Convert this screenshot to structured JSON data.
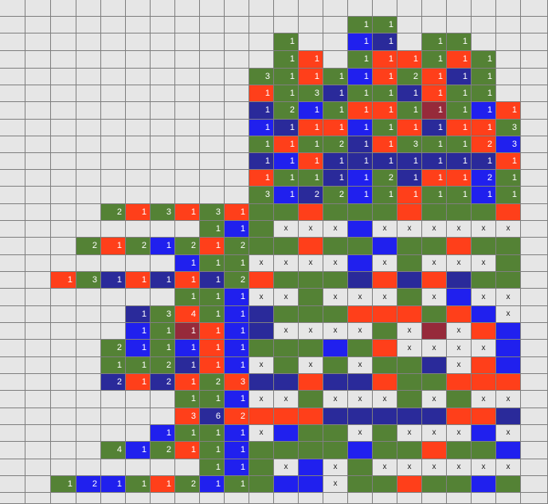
{
  "colors": {
    "e": "#e6e6e6",
    "g": "#548235",
    "r": "#ff3f1a",
    "b": "#2020ee",
    "n": "#2a2a9a",
    "m": "#962a3a",
    "gridline": "#7f7f7f"
  },
  "grid": {
    "columns": 22,
    "rows": 29,
    "cells": [
      [
        "e",
        "e",
        "e",
        "e",
        "e",
        "e",
        "e",
        "e",
        "e",
        "e",
        "e",
        "e",
        "e",
        "e",
        "e",
        "e",
        "e",
        "e",
        "e",
        "e",
        "e",
        "e"
      ],
      [
        "e",
        "e",
        "e",
        "e",
        "e",
        "e",
        "e",
        "e",
        "e",
        "e",
        "e",
        "e",
        "e",
        "e",
        "g:1",
        "g:1",
        "e",
        "e",
        "e",
        "e",
        "e",
        "e"
      ],
      [
        "e",
        "e",
        "e",
        "e",
        "e",
        "e",
        "e",
        "e",
        "e",
        "e",
        "e",
        "g:1",
        "e",
        "e",
        "b:1",
        "n:1",
        "e",
        "g:1",
        "g:1",
        "e",
        "e",
        "e"
      ],
      [
        "e",
        "e",
        "e",
        "e",
        "e",
        "e",
        "e",
        "e",
        "e",
        "e",
        "e",
        "g:1",
        "r:1",
        "e",
        "g:1",
        "r:1",
        "r:1",
        "g:1",
        "r:1",
        "g:1",
        "e",
        "e"
      ],
      [
        "e",
        "e",
        "e",
        "e",
        "e",
        "e",
        "e",
        "e",
        "e",
        "e",
        "g:3",
        "g:1",
        "r:1",
        "g:1",
        "b:1",
        "r:1",
        "g:2",
        "r:1",
        "n:1",
        "g:1",
        "e",
        "e"
      ],
      [
        "e",
        "e",
        "e",
        "e",
        "e",
        "e",
        "e",
        "e",
        "e",
        "e",
        "r:1",
        "g:1",
        "g:3",
        "n:1",
        "g:1",
        "g:1",
        "n:1",
        "r:1",
        "g:1",
        "g:1",
        "e",
        "e"
      ],
      [
        "e",
        "e",
        "e",
        "e",
        "e",
        "e",
        "e",
        "e",
        "e",
        "e",
        "n:1",
        "g:2",
        "b:1",
        "g:1",
        "r:1",
        "r:1",
        "g:1",
        "m:1",
        "g:1",
        "b:1",
        "r:1",
        "e"
      ],
      [
        "e",
        "e",
        "e",
        "e",
        "e",
        "e",
        "e",
        "e",
        "e",
        "e",
        "b:1",
        "n:1",
        "r:1",
        "r:1",
        "b:1",
        "g:1",
        "r:1",
        "n:1",
        "r:1",
        "r:1",
        "g:3",
        "e"
      ],
      [
        "e",
        "e",
        "e",
        "e",
        "e",
        "e",
        "e",
        "e",
        "e",
        "e",
        "g:1",
        "r:1",
        "g:1",
        "g:2",
        "n:1",
        "r:1",
        "g:3",
        "g:1",
        "g:1",
        "r:2",
        "b:3",
        "e"
      ],
      [
        "e",
        "e",
        "e",
        "e",
        "e",
        "e",
        "e",
        "e",
        "e",
        "e",
        "n:1",
        "b:1",
        "r:1",
        "n:1",
        "n:1",
        "n:1",
        "n:1",
        "n:1",
        "n:1",
        "n:1",
        "r:1",
        "e"
      ],
      [
        "e",
        "e",
        "e",
        "e",
        "e",
        "e",
        "e",
        "e",
        "e",
        "e",
        "r:1",
        "g:1",
        "g:1",
        "n:1",
        "b:1",
        "g:2",
        "n:1",
        "r:1",
        "r:1",
        "b:2",
        "g:1",
        "e"
      ],
      [
        "e",
        "e",
        "e",
        "e",
        "e",
        "e",
        "e",
        "e",
        "e",
        "e",
        "g:3",
        "b:1",
        "n:2",
        "g:2",
        "b:1",
        "g:1",
        "r:1",
        "g:1",
        "g:1",
        "b:1",
        "g:1",
        "e"
      ],
      [
        "e",
        "e",
        "e",
        "e",
        "g:2",
        "r:1",
        "g:3",
        "r:1",
        "g:3",
        "r:1",
        "g",
        "g",
        "r",
        "g",
        "g",
        "g",
        "r",
        "g",
        "g",
        "g",
        "r",
        "e"
      ],
      [
        "e",
        "e",
        "e",
        "e",
        "e",
        "e",
        "e",
        "e",
        "g:1",
        "b:1",
        "g",
        "x",
        "x",
        "x",
        "b",
        "x",
        "x",
        "x",
        "x",
        "x",
        "x",
        "e"
      ],
      [
        "e",
        "e",
        "e",
        "g:2",
        "r:1",
        "g:2",
        "b:1",
        "g:2",
        "r:1",
        "g:2",
        "g",
        "g",
        "r",
        "g",
        "g",
        "b",
        "g",
        "g",
        "r",
        "g",
        "g",
        "e"
      ],
      [
        "e",
        "e",
        "e",
        "e",
        "e",
        "e",
        "e",
        "b:1",
        "g:1",
        "g:1",
        "x",
        "x",
        "x",
        "x",
        "b",
        "x",
        "g",
        "x",
        "x",
        "x",
        "g",
        "e"
      ],
      [
        "e",
        "e",
        "r:1",
        "g:3",
        "n:1",
        "r:1",
        "n:1",
        "r:1",
        "n:1",
        "g:2",
        "r",
        "g",
        "g",
        "g",
        "n",
        "r",
        "n",
        "r",
        "n",
        "g",
        "g",
        "e"
      ],
      [
        "e",
        "e",
        "e",
        "e",
        "e",
        "e",
        "e",
        "g:1",
        "g:1",
        "b:1",
        "x",
        "x",
        "g",
        "x",
        "x",
        "x",
        "g",
        "x",
        "b",
        "x",
        "x",
        "e"
      ],
      [
        "e",
        "e",
        "e",
        "e",
        "e",
        "n:1",
        "g:3",
        "r:4",
        "g:1",
        "b:1",
        "n",
        "g",
        "g",
        "g",
        "r",
        "r",
        "r",
        "g",
        "r",
        "b",
        "x",
        "e"
      ],
      [
        "e",
        "e",
        "e",
        "e",
        "e",
        "b:1",
        "g:1",
        "m:1",
        "r:1",
        "b:1",
        "n",
        "x",
        "x",
        "x",
        "x",
        "g",
        "x",
        "m",
        "x",
        "r",
        "b",
        "e"
      ],
      [
        "e",
        "e",
        "e",
        "e",
        "g:2",
        "b:1",
        "g:1",
        "b:1",
        "r:1",
        "b:1",
        "g",
        "g",
        "g",
        "b",
        "g",
        "r",
        "x",
        "x",
        "x",
        "x",
        "b",
        "e"
      ],
      [
        "e",
        "e",
        "e",
        "e",
        "g:1",
        "g:1",
        "g:2",
        "n:1",
        "r:1",
        "b:1",
        "x",
        "g",
        "x",
        "g",
        "x",
        "g",
        "g",
        "n",
        "x",
        "r",
        "b",
        "e"
      ],
      [
        "e",
        "e",
        "e",
        "e",
        "n:2",
        "r:1",
        "n:2",
        "r:1",
        "g:2",
        "r:3",
        "n",
        "n",
        "r",
        "n",
        "n",
        "r",
        "g",
        "g",
        "r",
        "r",
        "r",
        "e"
      ],
      [
        "e",
        "e",
        "e",
        "e",
        "e",
        "e",
        "e",
        "g:1",
        "g:1",
        "b:1",
        "x",
        "x",
        "g",
        "x",
        "x",
        "x",
        "g",
        "x",
        "g",
        "x",
        "x",
        "e"
      ],
      [
        "e",
        "e",
        "e",
        "e",
        "e",
        "e",
        "e",
        "r:3",
        "n:6",
        "r:2",
        "r",
        "r",
        "r",
        "n",
        "n",
        "n",
        "n",
        "n",
        "r",
        "r",
        "n",
        "e"
      ],
      [
        "e",
        "e",
        "e",
        "e",
        "e",
        "e",
        "b:1",
        "g:1",
        "g:1",
        "b:1",
        "x",
        "b",
        "g",
        "g",
        "x",
        "g",
        "x",
        "x",
        "x",
        "b",
        "x",
        "e"
      ],
      [
        "e",
        "e",
        "e",
        "e",
        "g:4",
        "b:1",
        "g:2",
        "r:1",
        "g:1",
        "b:1",
        "g",
        "g",
        "g",
        "g",
        "b",
        "g",
        "g",
        "r",
        "g",
        "g",
        "b",
        "e"
      ],
      [
        "e",
        "e",
        "e",
        "e",
        "e",
        "e",
        "e",
        "e",
        "g:1",
        "b:1",
        "g",
        "x",
        "b",
        "x",
        "g",
        "x",
        "x",
        "x",
        "x",
        "x",
        "x",
        "e"
      ],
      [
        "e",
        "e",
        "g:1",
        "b:2",
        "b:1",
        "g:1",
        "r:1",
        "g:2",
        "b:1",
        "g:1",
        "g",
        "b",
        "b",
        "x",
        "g",
        "g",
        "r",
        "g",
        "g",
        "b",
        "g",
        "e"
      ]
    ]
  }
}
